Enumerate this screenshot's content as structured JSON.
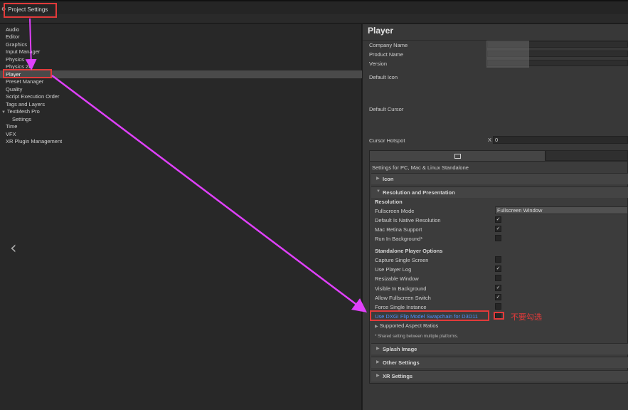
{
  "window": {
    "title": "Project Settings",
    "title_icon": "gear-icon"
  },
  "sidebar": {
    "items": [
      {
        "label": "Audio"
      },
      {
        "label": "Editor"
      },
      {
        "label": "Graphics"
      },
      {
        "label": "Input Manager"
      },
      {
        "label": "Physics"
      },
      {
        "label": "Physics 2D"
      },
      {
        "label": "Player",
        "selected": true
      },
      {
        "label": "Preset Manager"
      },
      {
        "label": "Quality"
      },
      {
        "label": "Script Execution Order"
      },
      {
        "label": "Tags and Layers"
      },
      {
        "label": "TextMesh Pro",
        "expanded": true
      },
      {
        "label": "Settings"
      },
      {
        "label": "Time"
      },
      {
        "label": "VFX"
      },
      {
        "label": "XR Plugin Management"
      }
    ]
  },
  "inspector": {
    "title": "Player",
    "company_label": "Company Name",
    "product_label": "Product Name",
    "version_label": "Version",
    "default_icon_label": "Default Icon",
    "default_cursor_label": "Default Cursor",
    "cursor_hotspot_label": "Cursor Hotspot",
    "hotspot_x_label": "X",
    "hotspot_x_value": "0",
    "platform_caption": "Settings for PC, Mac & Linux Standalone",
    "sections": {
      "icon": "Icon",
      "resolution": "Resolution and Presentation",
      "splash": "Splash Image",
      "other": "Other Settings",
      "xr": "XR Settings"
    },
    "resolution_heading": "Resolution",
    "fullscreen_mode_label": "Fullscreen Mode",
    "fullscreen_mode_value": "Fullscreen Window",
    "default_native_label": "Default Is Native Resolution",
    "mac_retina_label": "Mac Retina Support",
    "run_background_label": "Run In Background*",
    "standalone_heading": "Standalone Player Options",
    "capture_single_label": "Capture Single Screen",
    "use_player_log_label": "Use Player Log",
    "resizable_window_label": "Resizable Window",
    "visible_background_label": "Visible In Background",
    "allow_fullscreen_label": "Allow Fullscreen Switch",
    "force_single_label": "Force Single Instance",
    "dxgi_label": "Use DXGI Flip Model Swapchain for D3D11",
    "aspect_label": "Supported Aspect Ratios",
    "shared_note": "* Shared setting between multiple platforms.",
    "checks": {
      "default_native": true,
      "mac_retina": true,
      "run_background": false,
      "capture_single": false,
      "use_player_log": true,
      "resizable_window": false,
      "visible_background": true,
      "allow_fullscreen": true,
      "force_single": false,
      "dxgi": false
    }
  },
  "annotation": {
    "note": "不要勾选",
    "color": "#e23a3a",
    "arrow_color": "#e040fb"
  }
}
